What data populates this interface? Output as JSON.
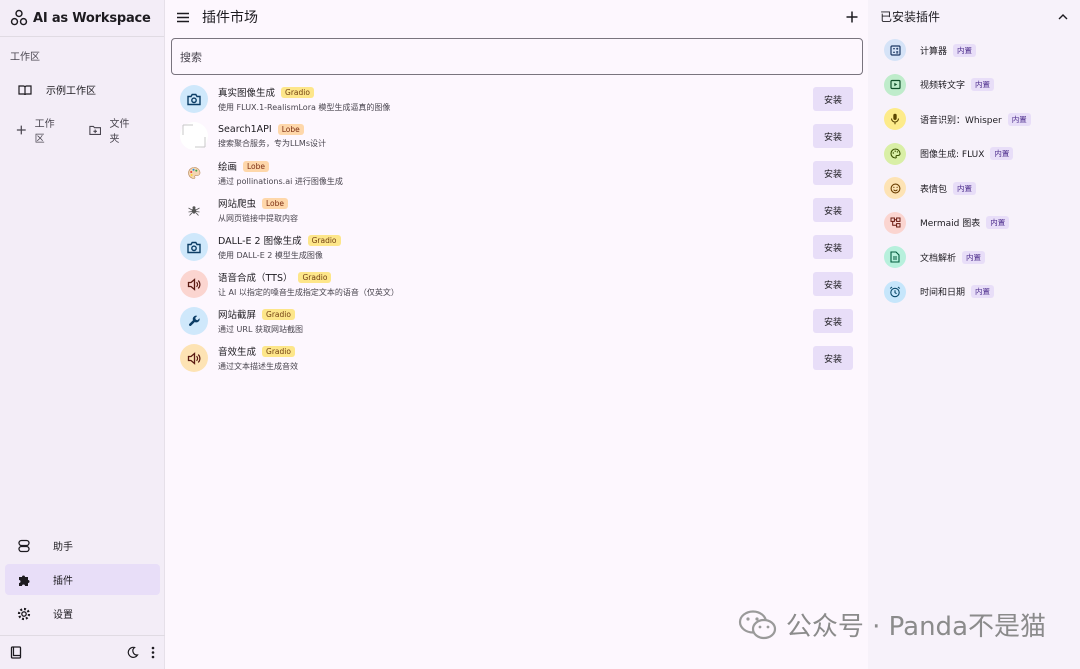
{
  "brand": {
    "name": "AI as Workspace"
  },
  "sidebar": {
    "section_title": "工作区",
    "workspace_item": "示例工作区",
    "add_workspace": "工作区",
    "add_folder": "文件夹",
    "nav": [
      {
        "label": "助手",
        "icon": "assistant-icon"
      },
      {
        "label": "插件",
        "icon": "puzzle-icon"
      },
      {
        "label": "设置",
        "icon": "gear-icon"
      }
    ]
  },
  "main": {
    "title": "插件市场",
    "search_placeholder": "搜索",
    "install_label": "安装",
    "plugins": [
      {
        "name": "真实图像生成",
        "tag": "Gradio",
        "desc": "使用 FLUX.1-RealismLora 模型生成逼真的图像",
        "icon": "camera-icon",
        "bg": "#cfe8fb"
      },
      {
        "name": "Search1API",
        "tag": "Lobe",
        "desc": "搜索聚合服务，专为LLMs设计",
        "icon": "broken-image-icon",
        "bg": "#ffffff"
      },
      {
        "name": "绘画",
        "tag": "Lobe",
        "desc": "通过 pollinations.ai 进行图像生成",
        "icon": "palette-emoji-icon",
        "bg": "transparent"
      },
      {
        "name": "网站爬虫",
        "tag": "Lobe",
        "desc": "从网页链接中提取内容",
        "icon": "spider-emoji-icon",
        "bg": "transparent"
      },
      {
        "name": "DALL-E 2 图像生成",
        "tag": "Gradio",
        "desc": "使用 DALL-E 2 模型生成图像",
        "icon": "camera-icon",
        "bg": "#cfe8fb"
      },
      {
        "name": "语音合成（TTS）",
        "tag": "Gradio",
        "desc": "让 AI 以指定的嗓音生成指定文本的语音（仅英文）",
        "icon": "speaker-icon",
        "bg": "#fbd5d0"
      },
      {
        "name": "网站截屏",
        "tag": "Gradio",
        "desc": "通过 URL 获取网站截图",
        "icon": "wrench-icon",
        "bg": "#cfe8fb"
      },
      {
        "name": "音效生成",
        "tag": "Gradio",
        "desc": "通过文本描述生成音效",
        "icon": "speaker-icon",
        "bg": "#fde3b4"
      }
    ]
  },
  "installed": {
    "title": "已安装插件",
    "builtin_label": "内置",
    "items": [
      {
        "name": "计算器",
        "icon": "calculator-icon",
        "bg": "#d5e3f7"
      },
      {
        "name": "视频转文字",
        "icon": "video-icon",
        "bg": "#bfeccb"
      },
      {
        "name": "语音识别：Whisper",
        "icon": "mic-icon",
        "bg": "#fdeb8a"
      },
      {
        "name": "图像生成: FLUX",
        "icon": "palette-icon",
        "bg": "#d9efa6"
      },
      {
        "name": "表情包",
        "icon": "smile-icon",
        "bg": "#fde3b4"
      },
      {
        "name": "Mermaid 图表",
        "icon": "diagram-icon",
        "bg": "#fbd5d0"
      },
      {
        "name": "文档解析",
        "icon": "document-icon",
        "bg": "#b7f0dc"
      },
      {
        "name": "时间和日期",
        "icon": "alarm-icon",
        "bg": "#c6e6fb"
      }
    ]
  },
  "watermark": "公众号 · Panda不是猫"
}
